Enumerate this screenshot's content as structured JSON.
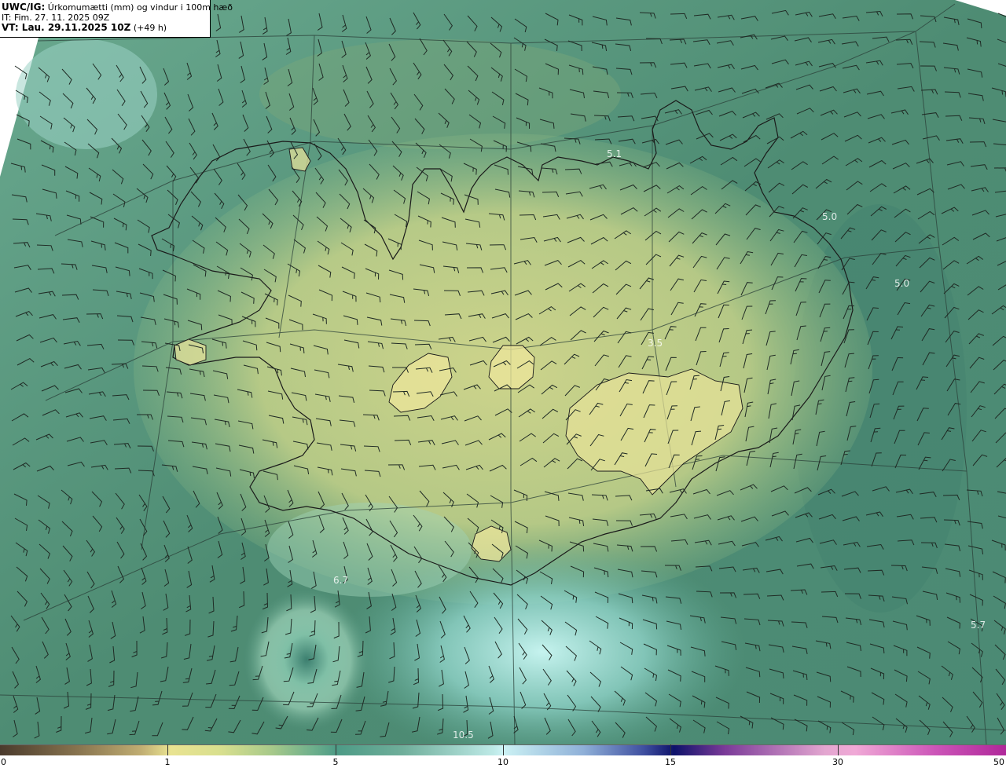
{
  "header": {
    "model_label": "UWC/IG:",
    "title": "Úrkomumætti (mm) og vindur i 100m hæð",
    "issue_time": "IT: Fim. 27. 11. 2025 09Z",
    "valid_label": "VT: Lau. 29.11.2025 10Z",
    "valid_offset": "(+49 h)"
  },
  "map_labels": [
    {
      "text": "5.1"
    },
    {
      "text": "5.0"
    },
    {
      "text": "5.0"
    },
    {
      "text": "3.5"
    },
    {
      "text": "6.7"
    },
    {
      "text": "5.7"
    },
    {
      "text": "10.5"
    }
  ],
  "colorbar": {
    "ticks": [
      "0",
      "1",
      "5",
      "10",
      "15",
      "30",
      "50"
    ],
    "colors": {
      "low": "#4a3a2c",
      "one": "#e9e391",
      "five": "#4d9b86",
      "ten": "#ccf2f4",
      "fifteen": "#0e126a",
      "thirty": "#f0a9d6",
      "fifty": "#b0289a"
    }
  },
  "map_colors": {
    "sea_green": "#4f8f78",
    "land_yellow": "#d6d88a",
    "cyan_band": "#a8e4de",
    "coast": "#1a1a1a"
  }
}
